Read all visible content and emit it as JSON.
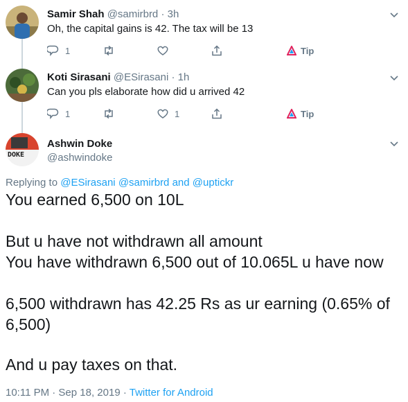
{
  "reply1": {
    "name": "Samir Shah",
    "handle": "@samirbrd",
    "separator": "·",
    "time": "3h",
    "text": "Oh, the capital gains is 42. The tax will be 13",
    "actions": {
      "reply_count": "1",
      "retweet_count": "",
      "like_count": "",
      "tip_label": "Tip"
    }
  },
  "reply2": {
    "name": "Koti Sirasani",
    "handle": "@ESirasani",
    "separator": "·",
    "time": "1h",
    "text": "Can you pls elaborate how did u arrived 42",
    "actions": {
      "reply_count": "1",
      "retweet_count": "",
      "like_count": "1",
      "tip_label": "Tip"
    }
  },
  "main": {
    "name": "Ashwin Doke",
    "handle": "@ashwindoke",
    "avatar_text": "DOKE",
    "replying_prefix": "Replying to",
    "mention1": "@ESirasani",
    "mention2": "@samirbrd",
    "and_word": "and",
    "mention3": "@uptickr",
    "lines": [
      "You earned 6,500 on 10L",
      "But u have not withdrawn all amount",
      "You have withdrawn 6,500 out of 10.065L u have now",
      "6,500 withdrawn has 42.25 Rs as ur earning (0.65% of",
      "6,500)",
      "And u pay taxes on that."
    ],
    "timestamp": "10:11 PM · Sep 18, 2019",
    "dot": "·",
    "source": "Twitter for Android"
  },
  "colors": {
    "link": "#1da1f2",
    "muted": "#657786",
    "text": "#14171a",
    "rail": "#ccd6dd",
    "tip": "#e0245e"
  }
}
